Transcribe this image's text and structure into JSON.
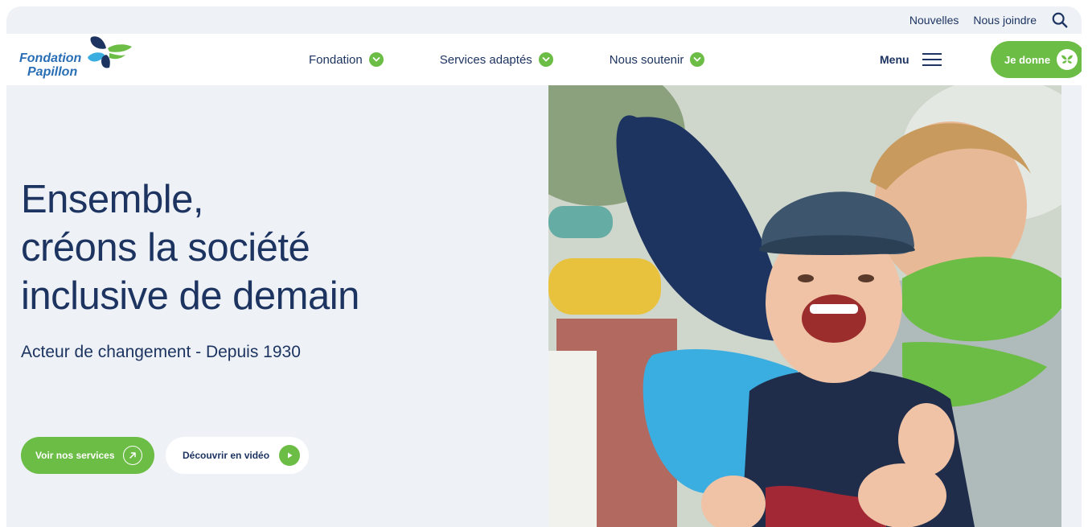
{
  "utility": {
    "news_label": "Nouvelles",
    "contact_label": "Nous joindre",
    "search_icon": "search-icon"
  },
  "header": {
    "logo": {
      "line1": "Fondation",
      "line2": "Papillon"
    },
    "nav": [
      {
        "label": "Fondation",
        "icon": "chevron-down-icon"
      },
      {
        "label": "Services adaptés",
        "icon": "chevron-down-icon"
      },
      {
        "label": "Nous soutenir",
        "icon": "chevron-down-icon"
      }
    ],
    "menu_label": "Menu",
    "donate_label": "Je donne"
  },
  "hero": {
    "title_lines": [
      "Ensemble,",
      "créons la société",
      "inclusive de demain"
    ],
    "subtitle": "Acteur de changement - Depuis 1930",
    "primary_cta": "Voir nos services",
    "secondary_cta": "Découvrir en vidéo"
  },
  "colors": {
    "navy": "#1d3461",
    "green": "#6cbd45",
    "light_blue": "#3aaee0",
    "background": "#eef2f7"
  }
}
